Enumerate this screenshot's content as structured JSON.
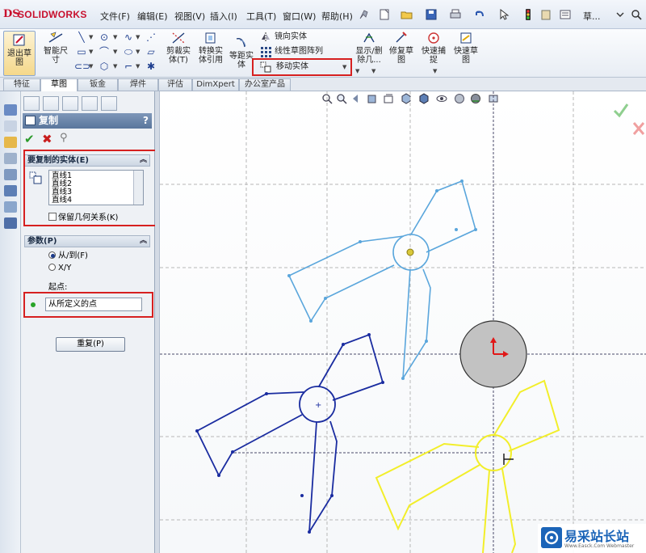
{
  "app": {
    "logo_text": "SOLIDWORKS",
    "logo_mark": "DS"
  },
  "menu": [
    "文件(F)",
    "编辑(E)",
    "视图(V)",
    "插入(I)",
    "工具(T)",
    "窗口(W)",
    "帮助(H)"
  ],
  "menu_extra": "草...",
  "ribbon": {
    "exit_sketch": "退出草图",
    "smart_dim": "智能尺寸",
    "trim": "剪裁实体(T)",
    "convert": "转换实体引用",
    "offset": "等距实体",
    "mirror": "镜向实体",
    "linear_pattern": "线性草图阵列",
    "move_entity": "移动实体",
    "show_delete": "显示/删除几...",
    "repair": "修复草图",
    "quick_snap": "快速捕捉",
    "rapid_sketch": "快速草图"
  },
  "tabs": [
    "特征",
    "草图",
    "钣金",
    "焊件",
    "评估",
    "DimXpert",
    "办公室产品"
  ],
  "active_tab": "草图",
  "pm": {
    "title": "复制",
    "help": "?",
    "entities_group": "要复制的实体(E)",
    "entities": [
      "直线1",
      "直线2",
      "直线3",
      "直线4"
    ],
    "keep_relations": "保留几何关系(K)",
    "params_group": "参数(P)",
    "option_from_to": "从/到(F)",
    "option_xy": "X/Y",
    "start_point_label": "起点:",
    "start_point_value": "从所定义的点",
    "reset_button": "重复(P)"
  },
  "watermark": {
    "text": "易采站长站",
    "small": "Www.Easck.Com Webmaster"
  },
  "colors": {
    "accent_red": "#d62020",
    "sketch_light": "#5aa6dc",
    "sketch_dark": "#1a2ca0",
    "sketch_copy": "#f2ee2a",
    "header_blue": "#5a769c"
  }
}
